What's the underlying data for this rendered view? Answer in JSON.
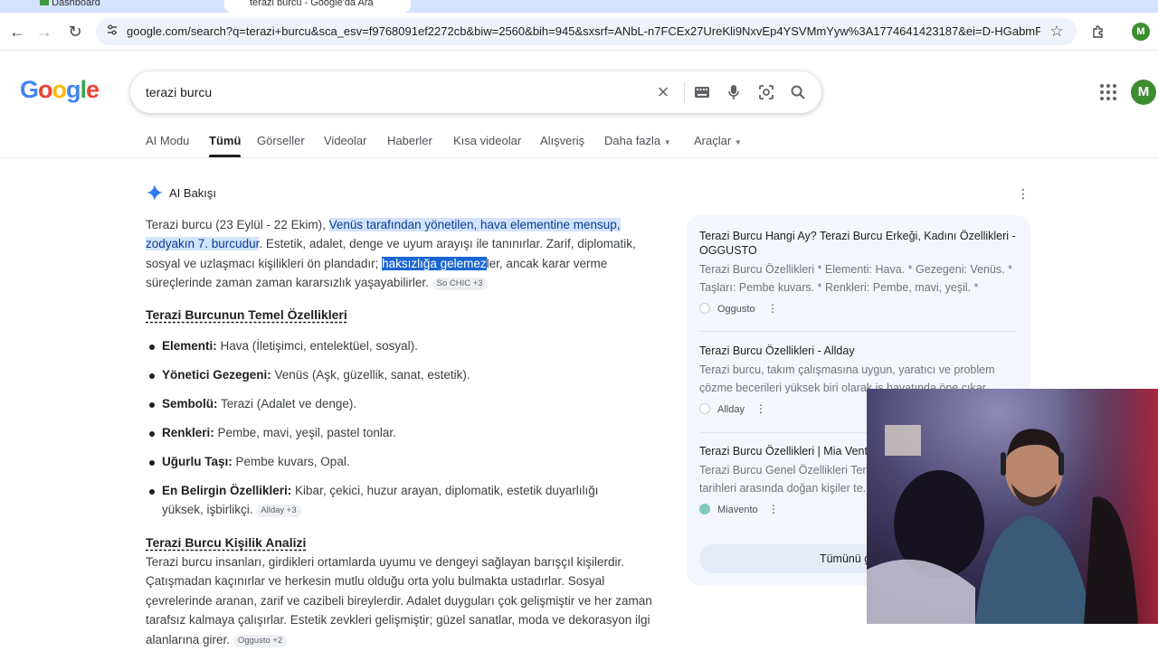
{
  "browser": {
    "tabs": [
      {
        "title": "Dashboard"
      },
      {
        "title": "terazi burcu - Google'da Ara"
      }
    ],
    "url": "google.com/search?q=terazi+burcu&sca_esv=f9768091ef2272cb&biw=2560&bih=945&sxsrf=ANbL-n7FCEx27UreKli9NxvEp4YSVMmYyw%3A1774641423187&ei=D-HGabmPC_WPxc...",
    "profile_initial": "M"
  },
  "google": {
    "logo_letters": [
      {
        "char": "G",
        "color": "#4285F4"
      },
      {
        "char": "o",
        "color": "#EA4335"
      },
      {
        "char": "o",
        "color": "#FBBC05"
      },
      {
        "char": "g",
        "color": "#4285F4"
      },
      {
        "char": "l",
        "color": "#34A853"
      },
      {
        "char": "e",
        "color": "#EA4335"
      }
    ],
    "query": "terazi burcu",
    "profile_initial": "M"
  },
  "nav": {
    "tabs": [
      "AI Modu",
      "Tümü",
      "Görseller",
      "Videolar",
      "Haberler",
      "Kısa videolar",
      "Alışveriş",
      "Daha fazla",
      "Araçlar"
    ],
    "active": "Tümü"
  },
  "ai_overview": {
    "heading": "AI Bakışı",
    "intro": {
      "p1": "Terazi burcu (23 Eylül - 22 Ekim), ",
      "highlight1": "Venüs tarafından yönetilen, hava elementine mensup, zodyakın 7. burcudur",
      "p2": ". Estetik, adalet, denge ve uyum arayışı ile tanınırlar. Zarif, diplomatik, sosyal ve uzlaşmacı kişilikleri ön plandadır; ",
      "selected": "haksızlığa gelemez",
      "p3": "ler, ancak karar verme süreçlerinde zaman zaman kararsızlık yaşayabilirler.",
      "chip": "So CHIC +3"
    },
    "section1_title": "Terazi Burcunun Temel Özellikleri",
    "traits": [
      {
        "label": "Elementi:",
        "value": " Hava (İletişimci, entelektüel, sosyal)."
      },
      {
        "label": "Yönetici Gezegeni:",
        "value": " Venüs (Aşk, güzellik, sanat, estetik)."
      },
      {
        "label": "Sembolü:",
        "value": " Terazi (Adalet ve denge)."
      },
      {
        "label": "Renkleri:",
        "value": " Pembe, mavi, yeşil, pastel tonlar."
      },
      {
        "label": "Uğurlu Taşı:",
        "value": " Pembe kuvars, Opal."
      },
      {
        "label": "En Belirgin Özellikleri:",
        "value": " Kibar, çekici, huzur arayan, diplomatik, estetik duyarlılığı",
        "value2": "yüksek, işbirlikçi.",
        "chip": "Allday +3"
      }
    ],
    "section2_title": "Terazi Burcu Kişilik Analizi",
    "analysis": "Terazi burcu insanları, girdikleri ortamlarda uyumu ve dengeyi sağlayan barışçıl kişilerdir. Çatışmadan kaçınırlar ve herkesin mutlu olduğu orta yolu bulmakta ustadırlar. Sosyal çevrelerinde aranan, zarif ve cazibeli bireylerdir. Adalet duyguları çok gelişmiştir ve her zaman tarafsız kalmaya çalışırlar. Estetik zevkleri gelişmiştir; güzel sanatlar, moda ve dekorasyon ilgi alanlarına girer.",
    "analysis_chip": "Oggusto +2"
  },
  "sources": {
    "items": [
      {
        "title": "Terazi Burcu Hangi Ay? Terazi Burcu Erkeği, Kadını Özellikleri - OGGUSTO",
        "snippet": "Terazi Burcu Özellikleri * Elementi: Hava. * Gezegeni: Venüs. * Taşları: Pembe kuvars. * Renkleri: Pembe, mavi, yeşil. * Genel...",
        "site": "Oggusto"
      },
      {
        "title": "Terazi Burcu Özellikleri - Allday",
        "snippet": "Terazi burcu, takım çalışmasına uygun, yaratıcı ve problem çözme becerileri yüksek biri olarak iş hayatında öne çıkar...",
        "site": "Allday"
      },
      {
        "title": "Terazi Burcu Özellikleri | Mia Vento",
        "snippet": "Terazi Burcu Genel Özellikleri Terazi burcu, 23 Eylül - 22 Ekim tarihleri arasında doğan kişiler te...",
        "site": "Miavento"
      }
    ],
    "show_all": "Tümünü göster"
  }
}
